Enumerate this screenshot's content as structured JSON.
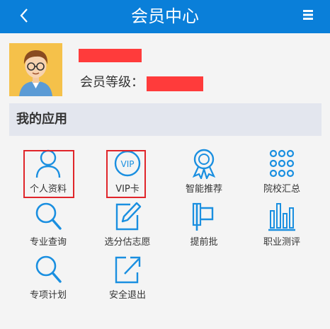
{
  "header": {
    "title": "会员中心",
    "back_icon": "chevron-left-icon",
    "menu_icon": "menu-icon"
  },
  "profile": {
    "level_label": "会员等级："
  },
  "section": {
    "title": "我的应用"
  },
  "apps": [
    {
      "label": "个人资料",
      "icon": "user-icon"
    },
    {
      "label": "VIP卡",
      "icon": "vip-icon"
    },
    {
      "label": "智能推荐",
      "icon": "award-icon"
    },
    {
      "label": "院校汇总",
      "icon": "grid-dots-icon"
    },
    {
      "label": "专业查询",
      "icon": "search-icon"
    },
    {
      "label": "选分估志愿",
      "icon": "edit-icon"
    },
    {
      "label": "提前批",
      "icon": "flag-icon"
    },
    {
      "label": "职业测评",
      "icon": "bar-chart-icon"
    },
    {
      "label": "专项计划",
      "icon": "search-icon"
    },
    {
      "label": "安全退出",
      "icon": "exit-icon"
    }
  ],
  "colors": {
    "header": "#0a7fd9",
    "icon": "#1a8fe0",
    "highlight": "#e0252a",
    "redaction": "#ff3b3b"
  }
}
